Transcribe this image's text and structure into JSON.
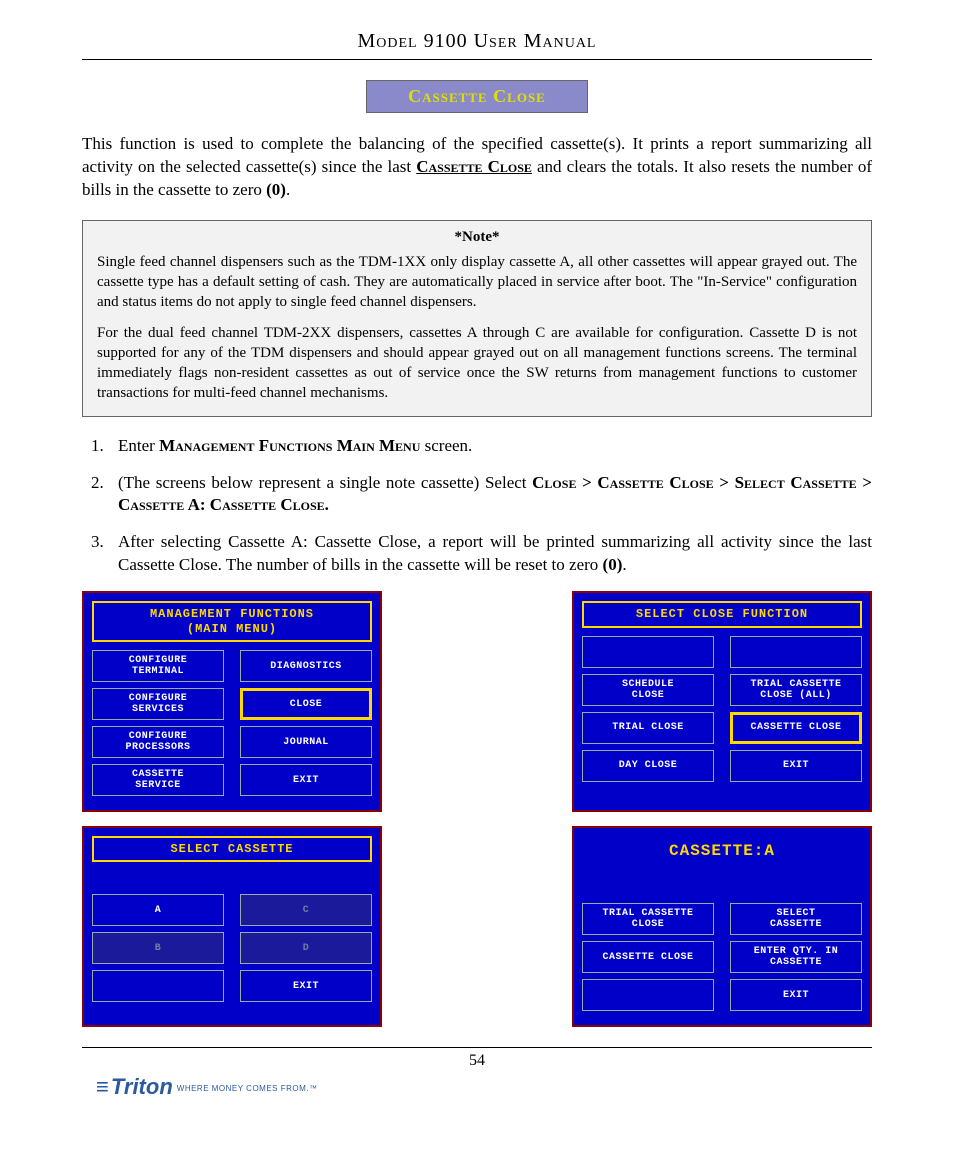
{
  "header": {
    "title": "Model 9100 User Manual"
  },
  "section_banner": "Cassette Close",
  "intro": {
    "pre": "This function is used to complete the balancing of the specified cassette(s). It prints a report summarizing all activity on the selected cassette(s) since the last ",
    "sc_ul": "Cassette Close",
    "post": " and clears the totals. It also resets the number of bills in the cassette to zero ",
    "bold_tail": "(0)",
    "period": "."
  },
  "note": {
    "title": "*Note*",
    "p1": "Single feed channel dispensers such as the TDM-1XX  only display cassette A, all other cassettes will appear grayed out.  The cassette type has a default setting of cash.  They are automatically placed in service after boot. The \"In-Service\" configuration and status items do not apply to single feed channel dispensers.",
    "p2": "For the dual feed channel TDM-2XX dispensers, cassettes A through C are available for configuration.  Cassette D is not supported for any of the TDM dispensers and should appear grayed out on all management functions screens.  The terminal immediately flags non-resident cassettes as out of service once the SW returns from management functions to customer transactions for multi-feed channel mechanisms."
  },
  "steps": {
    "s1": {
      "pre": "Enter ",
      "sc": "Management Functions Main Menu",
      "post": " screen."
    },
    "s2": {
      "pre": "(The screens below represent a single note cassette)  Select  ",
      "sc1": "Close > Cassette Close > Select Cassette  > Cassette A: Cassette Close."
    },
    "s3": {
      "text_pre": "After selecting Cassette A: Cassette Close, a report will be printed summarizing all activity since the last Cassette Close. The number of bills in the cassette will be reset to zero ",
      "bold_tail": "(0)",
      "period": "."
    }
  },
  "screens": {
    "s1": {
      "title_l1": "MANAGEMENT FUNCTIONS",
      "title_l2": "(MAIN MENU)",
      "buttons": {
        "r1l": "CONFIGURE\nTERMINAL",
        "r1r": "DIAGNOSTICS",
        "r2l": "CONFIGURE\nSERVICES",
        "r2r": "CLOSE",
        "r3l": "CONFIGURE\nPROCESSORS",
        "r3r": "JOURNAL",
        "r4l": "CASSETTE\nSERVICE",
        "r4r": "EXIT"
      },
      "highlight": "r2r"
    },
    "s2": {
      "title_l1": "SELECT CLOSE FUNCTION",
      "buttons": {
        "r1l": "",
        "r1r": "",
        "r2l": "SCHEDULE\nCLOSE",
        "r2r": "TRIAL CASSETTE\nCLOSE (ALL)",
        "r3l": "TRIAL CLOSE",
        "r3r": "CASSETTE CLOSE",
        "r4l": "DAY CLOSE",
        "r4r": "EXIT"
      },
      "highlight": "r3r"
    },
    "s3": {
      "title_l1": "SELECT CASSETTE",
      "buttons": {
        "r2l": "A",
        "r2r": "C",
        "r3l": "B",
        "r3r": "D",
        "r4r": "EXIT"
      }
    },
    "s4": {
      "title_l1": "CASSETTE:A",
      "buttons": {
        "r2l": "TRIAL CASSETTE\nCLOSE",
        "r2r": "SELECT\nCASSETTE",
        "r3l": "CASSETTE CLOSE",
        "r3r": "ENTER QTY. IN\nCASSETTE",
        "r4r": "EXIT"
      }
    }
  },
  "footer": {
    "page": "54",
    "brand": "Triton",
    "tagline": "WHERE MONEY COMES FROM.™"
  }
}
